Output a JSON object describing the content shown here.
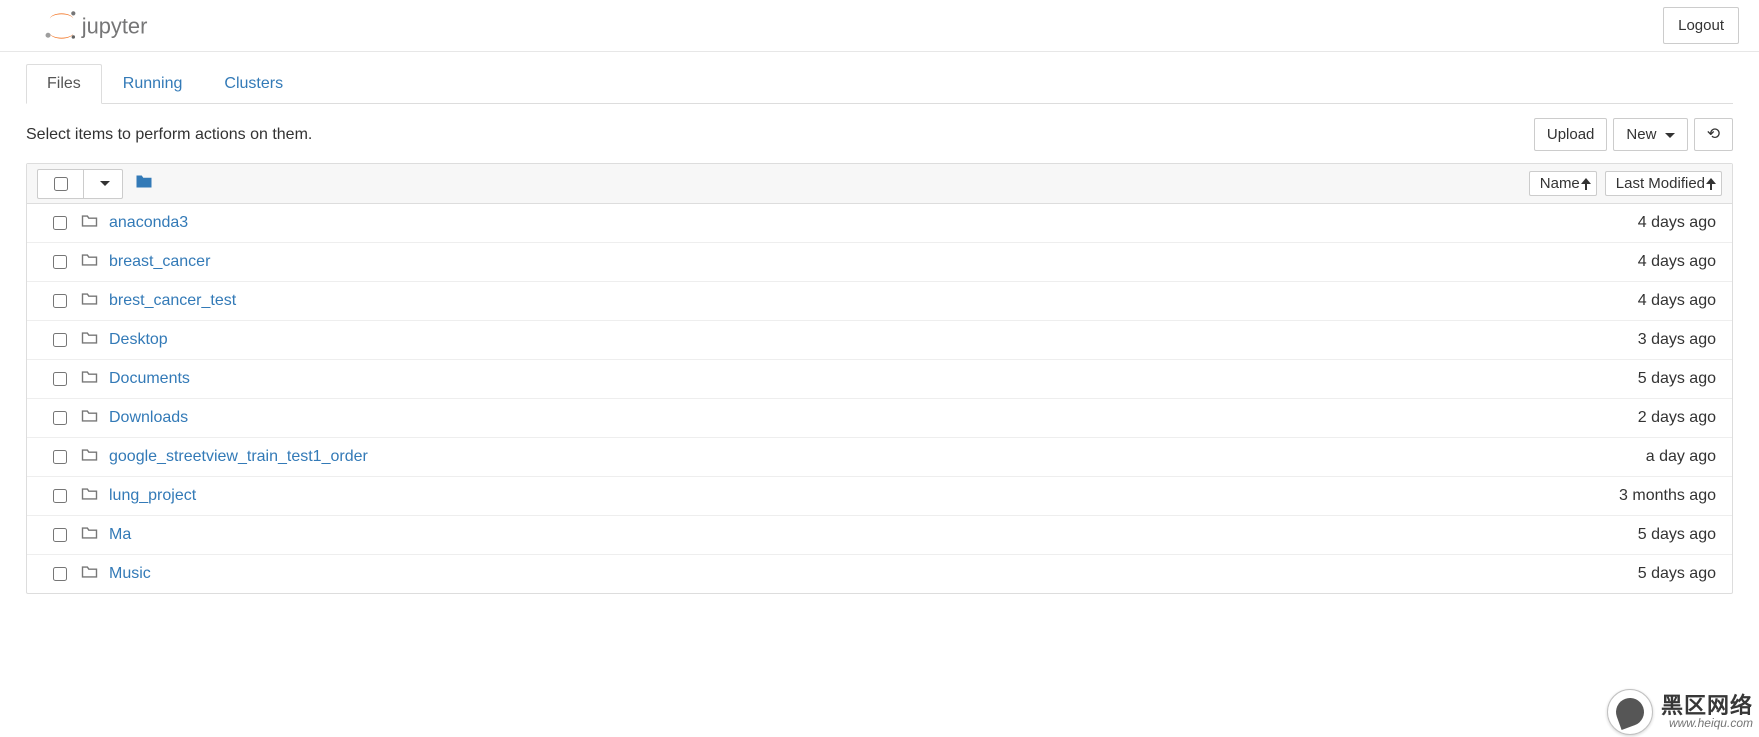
{
  "header": {
    "logo_text": "jupyter",
    "logout": "Logout"
  },
  "tabs": [
    {
      "label": "Files",
      "active": true
    },
    {
      "label": "Running",
      "active": false
    },
    {
      "label": "Clusters",
      "active": false
    }
  ],
  "toolbar": {
    "hint": "Select items to perform actions on them.",
    "upload": "Upload",
    "new": "New",
    "refresh_icon": "⟳"
  },
  "list_header": {
    "name_label": "Name",
    "modified_label": "Last Modified"
  },
  "items": [
    {
      "name": "anaconda3",
      "modified": "4 days ago"
    },
    {
      "name": "breast_cancer",
      "modified": "4 days ago"
    },
    {
      "name": "brest_cancer_test",
      "modified": "4 days ago"
    },
    {
      "name": "Desktop",
      "modified": "3 days ago"
    },
    {
      "name": "Documents",
      "modified": "5 days ago"
    },
    {
      "name": "Downloads",
      "modified": "2 days ago"
    },
    {
      "name": "google_streetview_train_test1_order",
      "modified": "a day ago"
    },
    {
      "name": "lung_project",
      "modified": "3 months ago"
    },
    {
      "name": "Ma",
      "modified": "5 days ago"
    },
    {
      "name": "Music",
      "modified": "5 days ago"
    }
  ],
  "watermark": {
    "big": "黑区网络",
    "small": "www.heiqu.com"
  }
}
